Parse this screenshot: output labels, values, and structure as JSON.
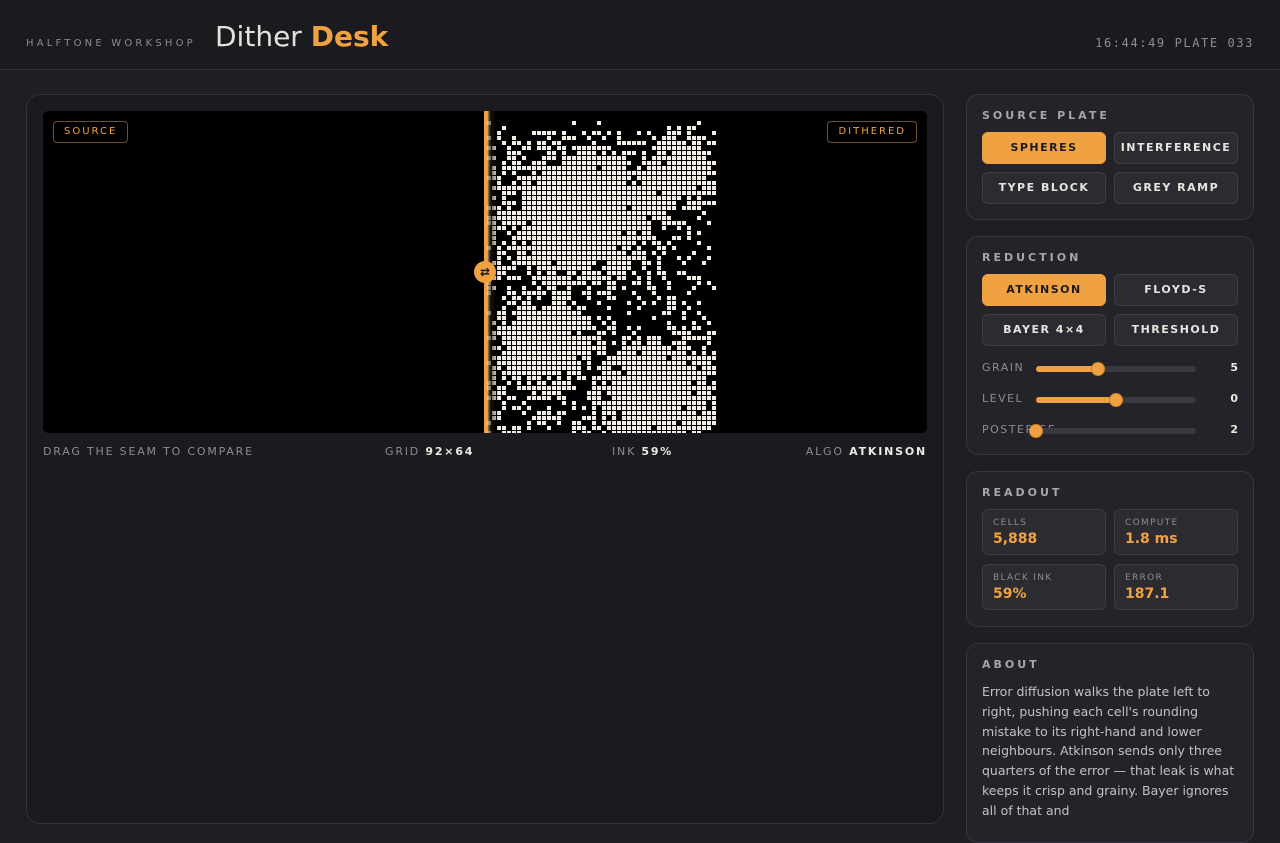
{
  "header": {
    "kicker": "HALFTONE WORKSHOP",
    "title_main": "Dither",
    "title_accent": "Desk",
    "clock": "16:44:49 PLATE 033"
  },
  "stage": {
    "tag_left": "SOURCE",
    "tag_right": "DITHERED",
    "seam_icon": "⇄",
    "footer": {
      "hint": "DRAG THE SEAM TO COMPARE",
      "grid_label": "GRID",
      "grid_value": "92×64",
      "ink_label": "INK",
      "ink_value": "59%",
      "algo_label": "ALGO",
      "algo_value": "ATKINSON"
    }
  },
  "source_plate": {
    "title": "SOURCE PLATE",
    "options": [
      "SPHERES",
      "INTERFERENCE",
      "TYPE BLOCK",
      "GREY RAMP"
    ],
    "selected": "SPHERES"
  },
  "reduction": {
    "title": "REDUCTION",
    "options": [
      "ATKINSON",
      "FLOYD-S",
      "BAYER 4×4",
      "THRESHOLD"
    ],
    "selected": "ATKINSON",
    "sliders": [
      {
        "label": "GRAIN",
        "value": "5",
        "fraction": 0.39
      },
      {
        "label": "LEVEL",
        "value": "0",
        "fraction": 0.5
      },
      {
        "label": "POSTERISE",
        "value": "2",
        "fraction": 0.0
      }
    ]
  },
  "readout": {
    "title": "READOUT",
    "stats": [
      {
        "label": "CELLS",
        "value": "5,888"
      },
      {
        "label": "COMPUTE",
        "value": "1.8 ms"
      },
      {
        "label": "BLACK INK",
        "value": "59%"
      },
      {
        "label": "ERROR",
        "value": "187.1"
      }
    ]
  },
  "about": {
    "title": "ABOUT",
    "text": "Error diffusion walks the plate left to right, pushing each cell's rounding mistake to its right-hand and lower neighbours. Atkinson sends only three quarters of the error — that leak is what keeps it crisp and grainy. Bayer ignores all of that and"
  },
  "colors": {
    "accent": "#f0a243",
    "background": "#1f1e24",
    "panel": "#24232a"
  }
}
